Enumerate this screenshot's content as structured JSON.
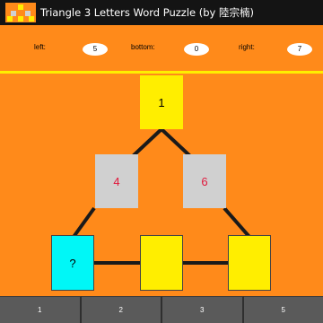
{
  "window": {
    "title": "Triangle 3 Letters Word Puzzle (by 陸宗楠)"
  },
  "scores": {
    "left_label": "left:",
    "left_value": "5",
    "bottom_label": "bottom:",
    "bottom_value": "0",
    "right_label": "right:",
    "right_value": "7"
  },
  "tiles": {
    "top": "1",
    "mid_left": "4",
    "mid_right": "6",
    "bottom_left": "?",
    "bottom_mid": "",
    "bottom_right": ""
  },
  "buttons": [
    "1",
    "2",
    "3",
    "5"
  ],
  "colors": {
    "background": "#ff8a1a",
    "titlebar": "#141414",
    "tile_yellow": "#ffee00",
    "tile_gray": "#d0d0d0",
    "tile_cyan": "#00f7f7",
    "number_red": "#e0183c",
    "button_bar": "#5a5a5a"
  }
}
